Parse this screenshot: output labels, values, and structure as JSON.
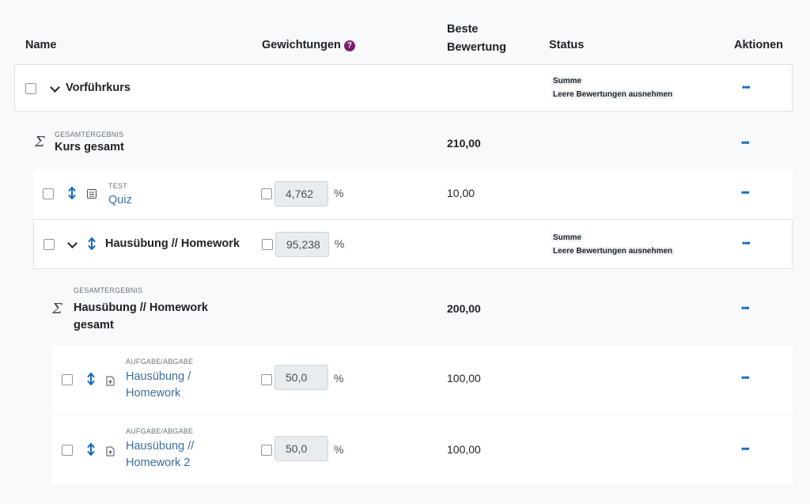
{
  "header": {
    "name": "Name",
    "weights": "Gewichtungen",
    "best_line1": "Beste",
    "best_line2": "Bewertung",
    "status": "Status",
    "actions": "Aktionen"
  },
  "course": {
    "title": "Vorführkurs",
    "status1": "Summe",
    "status2": "Leere Bewertungen ausnehmen"
  },
  "course_total": {
    "type": "GESAMTERGEBNIS",
    "title": "Kurs gesamt",
    "best": "210,00"
  },
  "quiz": {
    "type": "TEST",
    "title": "Quiz",
    "weight": "4,762",
    "unit": "%",
    "best": "10,00"
  },
  "homework_cat": {
    "title": "Hausübung // Homework",
    "weight": "95,238",
    "unit": "%",
    "status1": "Summe",
    "status2": "Leere Bewertungen ausnehmen"
  },
  "homework_total": {
    "type": "GESAMTERGEBNIS",
    "title_line1": "Hausübung // Homework",
    "title_line2": "gesamt",
    "best": "200,00"
  },
  "assign1": {
    "type": "AUFGABE/ABGABE",
    "title_line1": "Hausübung /",
    "title_line2": "Homework",
    "weight": "50,0",
    "unit": "%",
    "best": "100,00"
  },
  "assign2": {
    "type": "AUFGABE/ABGABE",
    "title_line1": "Hausübung //",
    "title_line2": "Homework 2",
    "weight": "50,0",
    "unit": "%",
    "best": "100,00"
  },
  "actions_label": "•••",
  "help_glyph": "?"
}
